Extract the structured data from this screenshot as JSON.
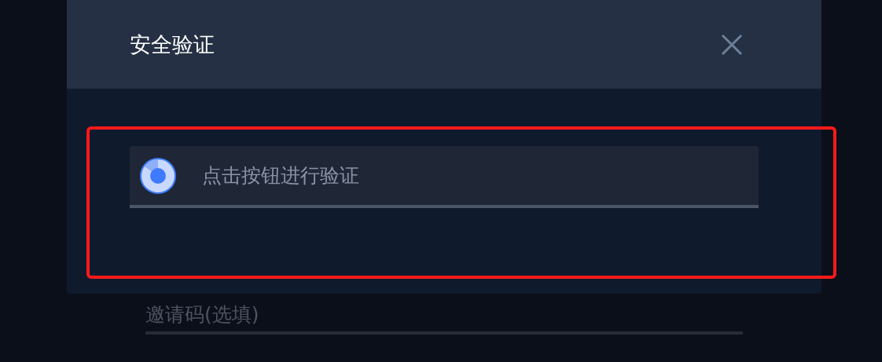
{
  "dialog": {
    "title": "安全验证",
    "captcha_button": {
      "label": "点击按钮进行验证"
    }
  },
  "invite_field": {
    "placeholder": "邀请码(选填)"
  }
}
